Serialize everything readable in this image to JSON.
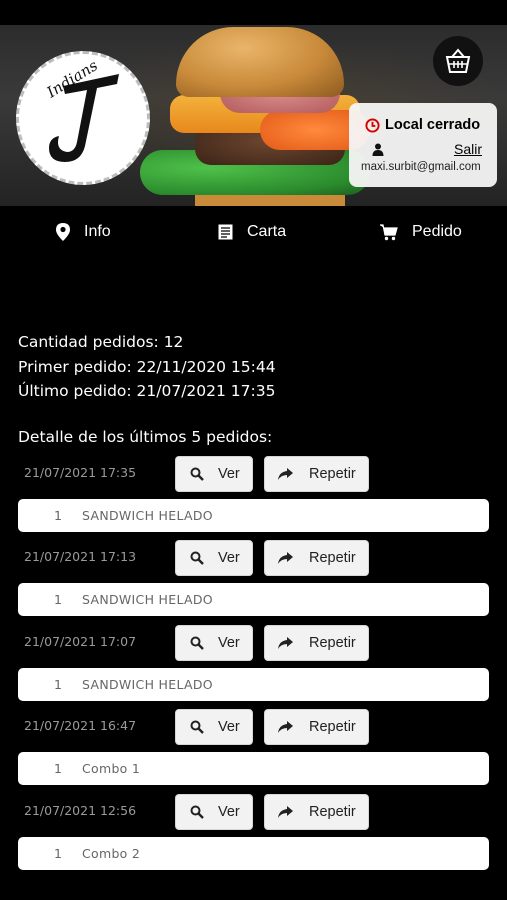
{
  "header": {
    "logo_text": "Indians",
    "status_label": "Local cerrado",
    "logout_label": "Salir",
    "user_email": "maxi.surbit@gmail.com",
    "status_color": "#d40000"
  },
  "nav": {
    "items": [
      {
        "label": "Info",
        "icon": "map-pin-icon"
      },
      {
        "label": "Carta",
        "icon": "menu-list-icon"
      },
      {
        "label": "Pedido",
        "icon": "cart-icon"
      }
    ]
  },
  "stats": {
    "count_line": "Cantidad pedidos: 12",
    "first_line": "Primer pedido: 22/11/2020 15:44",
    "last_line": "Último pedido: 21/07/2021 17:35"
  },
  "detail": {
    "title": "Detalle de los últimos 5 pedidos:"
  },
  "buttons": {
    "view_label": "Ver",
    "repeat_label": "Repetir"
  },
  "orders": [
    {
      "date": "21/07/2021 17:35",
      "items": [
        {
          "qty": "1",
          "name": "SANDWICH HELADO"
        }
      ]
    },
    {
      "date": "21/07/2021 17:13",
      "items": [
        {
          "qty": "1",
          "name": "SANDWICH HELADO"
        }
      ]
    },
    {
      "date": "21/07/2021 17:07",
      "items": [
        {
          "qty": "1",
          "name": "SANDWICH HELADO"
        }
      ]
    },
    {
      "date": "21/07/2021 16:47",
      "items": [
        {
          "qty": "1",
          "name": "Combo 1"
        }
      ]
    },
    {
      "date": "21/07/2021 12:56",
      "items": [
        {
          "qty": "1",
          "name": "Combo 2"
        }
      ]
    }
  ]
}
